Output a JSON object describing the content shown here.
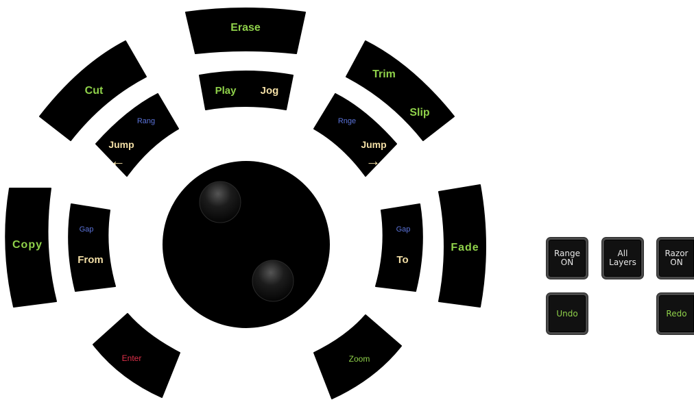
{
  "wheel": {
    "erase": "Erase",
    "play": "Play",
    "jog": "Jog",
    "cut": "Cut",
    "trim": "Trim",
    "slip": "Slip",
    "jump_left_range": "Rang",
    "jump_left": "Jump",
    "jump_left_arrow": "←",
    "jump_right_range": "Rnge",
    "jump_right": "Jump",
    "jump_right_arrow": "→",
    "copy": "Copy",
    "from_gap": "Gap",
    "from": "From",
    "to_gap": "Gap",
    "to": "To",
    "fade": "Fade",
    "enter": "Enter",
    "zoom": "Zoom"
  },
  "side_panel": {
    "range_on": "Range\nON",
    "all_layers": "All\nLayers",
    "razor_on": "Razor\nON",
    "undo": "Undo",
    "redo": "Redo"
  },
  "colors": {
    "accent_green": "#8fd14a",
    "label_cream": "#f3dfa6",
    "label_blue": "#5b73d9",
    "label_red": "#e0304a",
    "key_black": "#000000"
  }
}
